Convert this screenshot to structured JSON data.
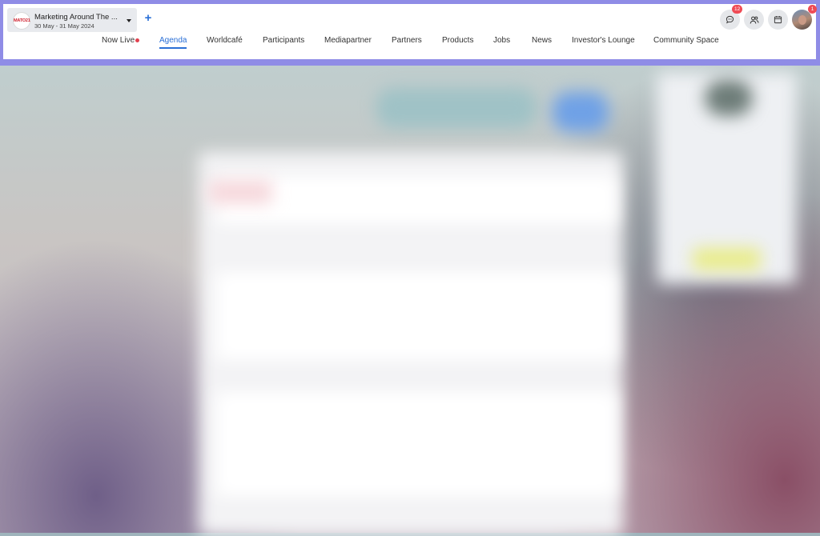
{
  "event": {
    "title": "Marketing Around The ...",
    "dates": "30 May - 31 May 2024",
    "logo_text": "MATO21"
  },
  "actions": {
    "add_label": "+"
  },
  "nav": {
    "items": [
      {
        "label": "Now Live",
        "live": true
      },
      {
        "label": "Agenda",
        "active": true
      },
      {
        "label": "Worldcafé"
      },
      {
        "label": "Participants"
      },
      {
        "label": "Mediapartner"
      },
      {
        "label": "Partners"
      },
      {
        "label": "Products"
      },
      {
        "label": "Jobs"
      },
      {
        "label": "News"
      },
      {
        "label": "Investor's Lounge"
      },
      {
        "label": "Community Space"
      }
    ]
  },
  "toolbar": {
    "chat_icon": "chat-icon",
    "chat_badge": "12",
    "people_icon": "people-icon",
    "calendar_icon": "calendar-icon",
    "avatar_badge": "1"
  },
  "colors": {
    "accent": "#2a6fd6",
    "live_dot": "#e2414f",
    "badge": "#ef4b55",
    "highlight_frame": "#8f8ce6"
  }
}
